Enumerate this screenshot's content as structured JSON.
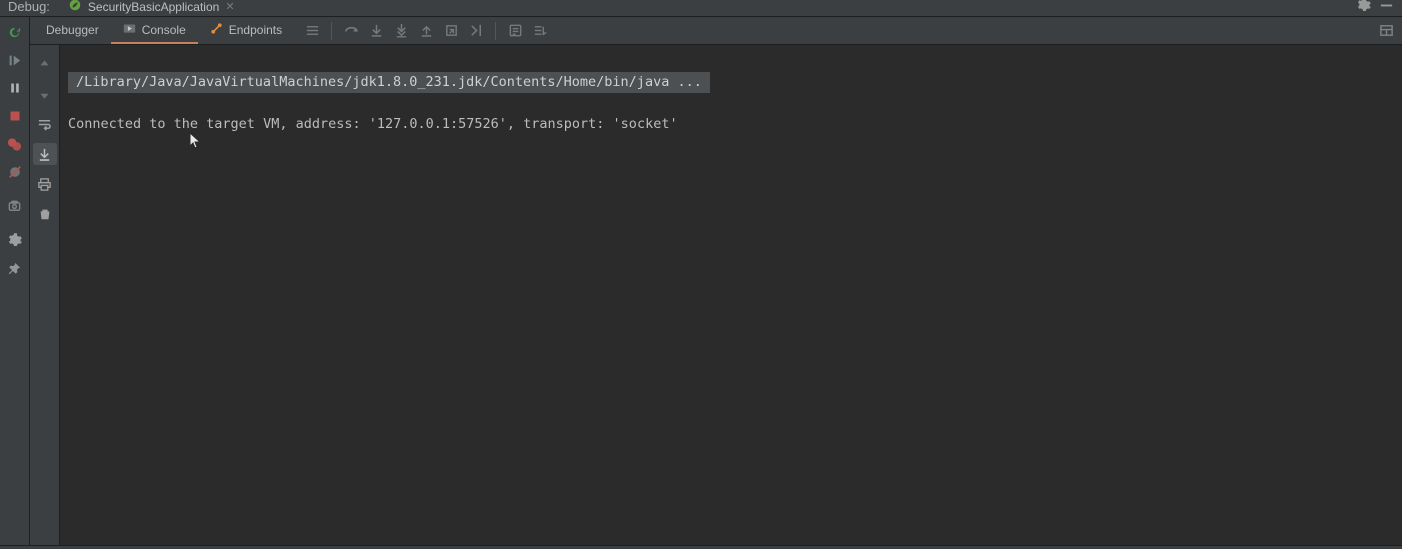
{
  "header": {
    "title": "Debug:",
    "run_config": "SecurityBasicApplication"
  },
  "tabs": {
    "debugger": "Debugger",
    "console": "Console",
    "endpoints": "Endpoints"
  },
  "console": {
    "cmd": "/Library/Java/JavaVirtualMachines/jdk1.8.0_231.jdk/Contents/Home/bin/java ...",
    "line": "Connected to the target VM, address: '127.0.0.1:57526', transport: 'socket'"
  },
  "icons": {
    "gear": "gear-icon",
    "minimize": "minimize-icon",
    "spring": "spring-icon",
    "rerun": "rerun-icon",
    "resume": "resume-icon",
    "pause": "pause-icon",
    "stop": "stop-icon",
    "view_breakpoints": "view-breakpoints-icon",
    "mute_breakpoints": "mute-breakpoints-icon",
    "camera": "camera-thread-dump-icon",
    "settings": "settings-icon",
    "pin": "pin-tab-icon",
    "up_stack": "up-stack-icon",
    "down_stack": "down-stack-icon",
    "soft_wrap": "soft-wrap-icon",
    "scroll_end": "scroll-to-end-icon",
    "print": "print-icon",
    "clear": "clear-all-icon",
    "console_play": "console-play-icon",
    "endpoints_icon": "endpoints-icon",
    "layout": "layout-settings-icon",
    "step_over": "step-over-icon",
    "step_into": "step-into-icon",
    "force_step_into": "force-step-into-icon",
    "step_out": "step-out-icon",
    "drop_frame": "drop-frame-icon",
    "run_to_cursor": "run-to-cursor-icon",
    "evaluate": "evaluate-expression-icon",
    "trace": "trace-current-stream-chain-icon",
    "show_exec": "show-execution-point-icon"
  }
}
